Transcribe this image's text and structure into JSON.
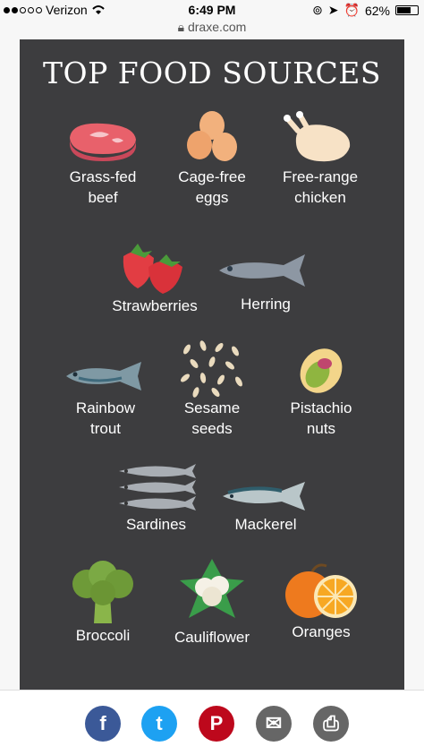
{
  "status": {
    "carrier": "Verizon",
    "time": "6:49 PM",
    "battery": "62%"
  },
  "browser": {
    "url": "draxe.com"
  },
  "infographic": {
    "title": "TOP FOOD SOURCES",
    "items": [
      {
        "label": "Grass-fed\nbeef",
        "icon": "steak-icon"
      },
      {
        "label": "Cage-free\neggs",
        "icon": "eggs-icon"
      },
      {
        "label": "Free-range\nchicken",
        "icon": "chicken-icon"
      },
      {
        "label": "Strawberries",
        "icon": "strawberries-icon"
      },
      {
        "label": "Herring",
        "icon": "herring-icon"
      },
      {
        "label": "Rainbow\ntrout",
        "icon": "trout-icon"
      },
      {
        "label": "Sesame\nseeds",
        "icon": "sesame-seeds-icon"
      },
      {
        "label": "Pistachio\nnuts",
        "icon": "pistachio-icon"
      },
      {
        "label": "Sardines",
        "icon": "sardines-icon"
      },
      {
        "label": "Mackerel",
        "icon": "mackerel-icon"
      },
      {
        "label": "Broccoli",
        "icon": "broccoli-icon"
      },
      {
        "label": "Cauliflower",
        "icon": "cauliflower-icon"
      },
      {
        "label": "Oranges",
        "icon": "oranges-icon"
      }
    ]
  },
  "share": {
    "buttons": [
      {
        "icon": "facebook-icon",
        "glyph": "f",
        "color": "#3b5998"
      },
      {
        "icon": "twitter-icon",
        "glyph": "t",
        "color": "#1da1f2"
      },
      {
        "icon": "pinterest-icon",
        "glyph": "P",
        "color": "#bd081c"
      },
      {
        "icon": "email-icon",
        "glyph": "✉",
        "color": "#666666"
      },
      {
        "icon": "print-icon",
        "glyph": "⎙",
        "color": "#666666"
      }
    ]
  }
}
